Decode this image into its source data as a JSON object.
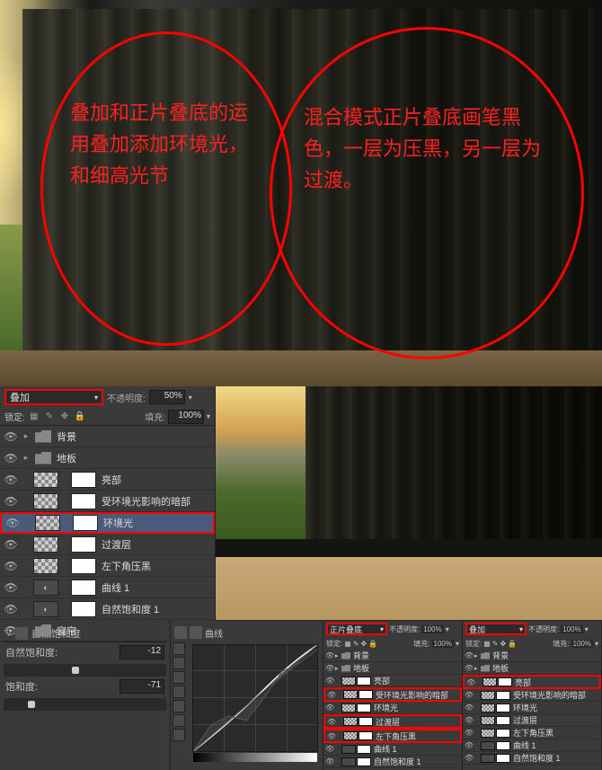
{
  "annotations": {
    "left": "叠加和正片叠底的运用叠加添加环境光，和细高光节",
    "right": "混合模式正片叠底画笔黑色，一层为压黑，另一层为过渡。"
  },
  "main_panel": {
    "blend_mode": "叠加",
    "opacity_label": "不透明度:",
    "opacity_value": "50%",
    "lock_label": "锁定:",
    "fill_label": "填充:",
    "fill_value": "100%"
  },
  "layers": [
    {
      "name": "背景",
      "type": "group"
    },
    {
      "name": "地板",
      "type": "group"
    },
    {
      "name": "亮部",
      "type": "layer",
      "thumb": "checker"
    },
    {
      "name": "受环境光影响的暗部",
      "type": "layer",
      "thumb": "checker"
    },
    {
      "name": "环境光",
      "type": "layer",
      "thumb": "checker",
      "highlighted": true
    },
    {
      "name": "过渡层",
      "type": "layer",
      "thumb": "checker"
    },
    {
      "name": "左下角压黑",
      "type": "layer",
      "thumb": "checker"
    },
    {
      "name": "曲线 1",
      "type": "adj"
    },
    {
      "name": "自然饱和度 1",
      "type": "adj"
    },
    {
      "name": "窗帘",
      "type": "group"
    }
  ],
  "sat_panel": {
    "title": "自然饱和度",
    "vibrance_label": "自然饱和度:",
    "vibrance_value": "-12",
    "saturation_label": "饱和度:",
    "saturation_value": "-71"
  },
  "curves_panel": {
    "title": "曲线"
  },
  "mini_left": {
    "blend_mode": "正片叠底",
    "opacity_label": "不透明度:",
    "opacity_value": "100%",
    "lock_label": "锁定:",
    "fill_label": "填充:",
    "fill_value": "100%",
    "layers": [
      {
        "name": "背景",
        "type": "group"
      },
      {
        "name": "地板",
        "type": "group"
      },
      {
        "name": "亮部",
        "type": "layer"
      },
      {
        "name": "受环境光影响的暗部",
        "type": "layer",
        "highlighted": true
      },
      {
        "name": "环境光",
        "type": "layer"
      },
      {
        "name": "过渡层",
        "type": "layer",
        "highlighted": true
      },
      {
        "name": "左下角压黑",
        "type": "layer",
        "highlighted": true
      },
      {
        "name": "曲线 1",
        "type": "adj"
      },
      {
        "name": "自然饱和度 1",
        "type": "adj"
      }
    ]
  },
  "mini_right": {
    "blend_mode": "叠加",
    "opacity_label": "不透明度:",
    "opacity_value": "100%",
    "lock_label": "锁定:",
    "fill_label": "填充:",
    "fill_value": "100%",
    "layers": [
      {
        "name": "背景",
        "type": "group"
      },
      {
        "name": "地板",
        "type": "group"
      },
      {
        "name": "亮部",
        "type": "layer",
        "highlighted": true
      },
      {
        "name": "受环境光影响的暗部",
        "type": "layer"
      },
      {
        "name": "环境光",
        "type": "layer"
      },
      {
        "name": "过渡层",
        "type": "layer"
      },
      {
        "name": "左下角压黑",
        "type": "layer"
      },
      {
        "name": "曲线 1",
        "type": "adj"
      },
      {
        "name": "自然饱和度 1",
        "type": "adj"
      }
    ]
  }
}
